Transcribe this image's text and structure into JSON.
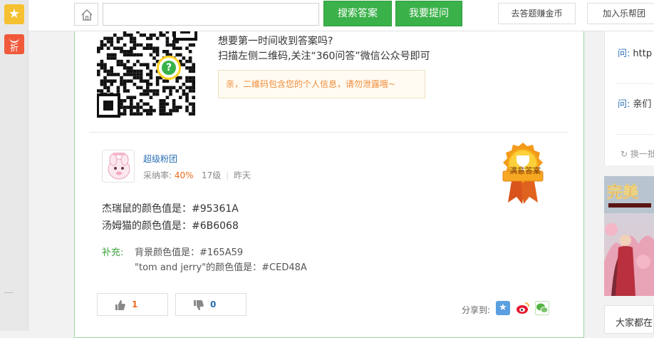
{
  "toolbar": {
    "search_placeholder": "",
    "search_button": "搜索答案",
    "ask_button": "我要提问",
    "earn_coins": "去答题赚金币",
    "join_group": "加入乐帮团"
  },
  "sidebar": {
    "discount_label": "折"
  },
  "promo": {
    "line1": "想要第一时间收到答案吗?",
    "line2": "扫描左侧二维码,关注“360问答”微信公众号即可",
    "tip": "亲，二维码包含您的个人信息，请勿泄露哦~"
  },
  "answer": {
    "username": "超级粉团",
    "acceptance_label": "采纳率:",
    "acceptance_rate": "40%",
    "level": "17级",
    "time": "昨天",
    "badge": "满意答案",
    "lines": [
      "杰瑞鼠的颜色值是：#95361A",
      "汤姆猫的颜色值是：#6B6068"
    ],
    "supplement_label": "补充:",
    "supplement_lines": [
      "背景颜色值是：#165A59",
      "\"tom and jerry\"的颜色值是：#CED48A"
    ],
    "likes": "1",
    "dislikes": "0",
    "share_label": "分享到:"
  },
  "right": {
    "q_prefix": "问:",
    "q1": "http",
    "q2": "亲们",
    "refresh": "换一批",
    "bottom_title": "大家都在"
  },
  "colors": {
    "accent_green": "#3bb14a",
    "link_blue": "#2a6fb5",
    "rate_orange": "#f06a1e"
  }
}
